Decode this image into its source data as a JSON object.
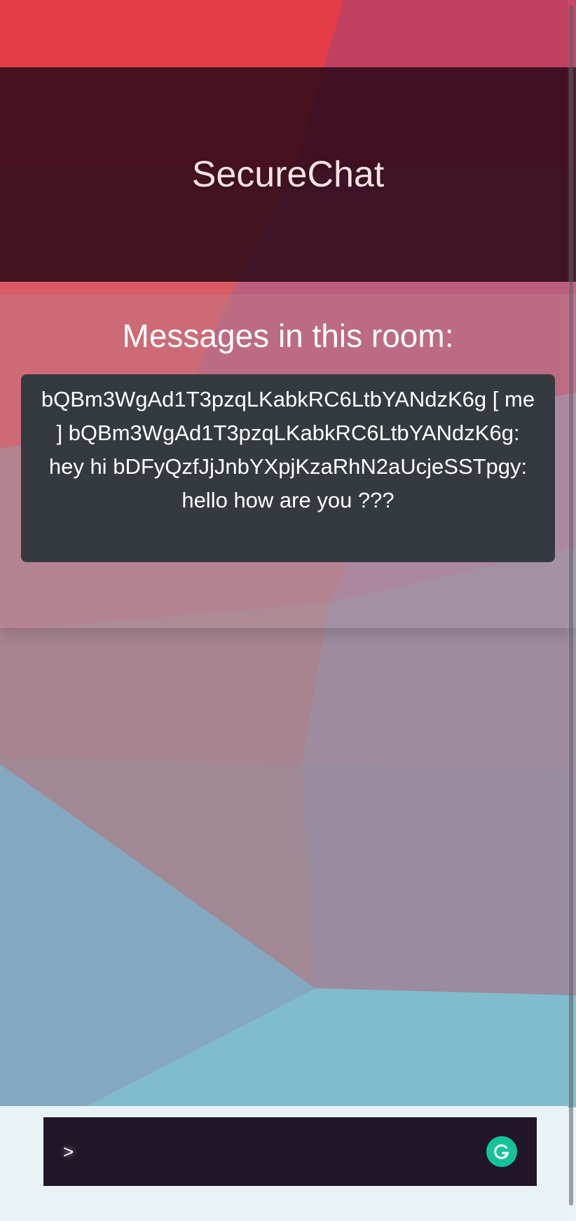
{
  "app": {
    "title": "SecureChat"
  },
  "room": {
    "heading": "Messages in this room:",
    "messages": [
      "bQBm3WgAd1T3pzqLKabkRC6LtbYANdzK6g [ me ]",
      "bQBm3WgAd1T3pzqLKabkRC6LtbYANdzK6g: hey hi",
      "bDFyQzfJjJnbYXpjKzaRhN2aUcjeSSTpgy: hello how are you ???"
    ]
  },
  "composer": {
    "prompt": ">",
    "value": "",
    "placeholder": "",
    "assistant_icon": "grammarly-icon"
  },
  "colors": {
    "header_bg": "#280818",
    "messages_bg": "#343a40",
    "input_bg": "#211528",
    "assistant_accent": "#15c39a"
  }
}
